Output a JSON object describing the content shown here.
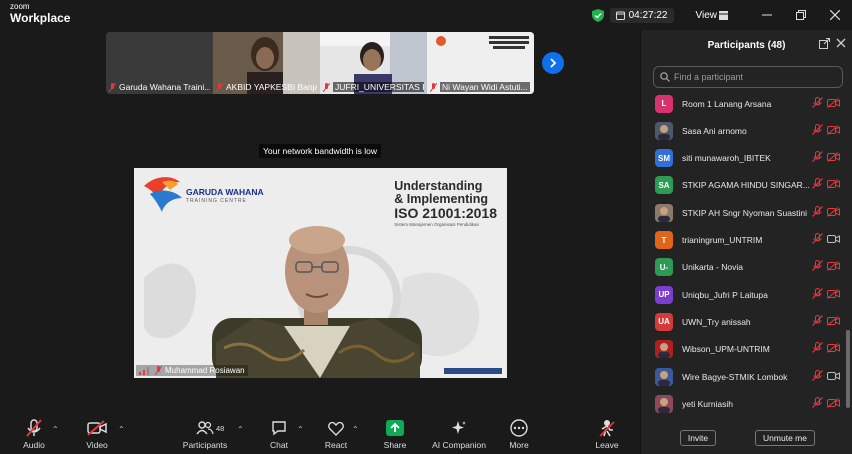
{
  "brand": {
    "line1": "zoom",
    "line2": "Workplace"
  },
  "titlebar": {
    "time": "04:27:22",
    "view_label": "View"
  },
  "thumbnails": [
    {
      "name": "Garuda Wahana Traini..."
    },
    {
      "name": "AKBID YAPKESBI Banja..."
    },
    {
      "name": "JUFRI_UNIVERSITAS R..."
    },
    {
      "name": "Ni Wayan Widi Astuti..."
    }
  ],
  "notice": "Your network bandwidth is low",
  "main_video": {
    "name": "Muhammad Rosiawan",
    "logo_title": "GARUDA WAHANA",
    "logo_sub": "TRAINING CENTRE",
    "slide_line1": "Understanding",
    "slide_line2": "& Implementing",
    "slide_line3": "ISO 21001:2018",
    "slide_line4": "Sistem Manajemen Organisasi Pendidikan"
  },
  "toolbar": {
    "audio": "Audio",
    "video": "Video",
    "participants": "Participants",
    "participants_count": "48",
    "chat": "Chat",
    "react": "React",
    "share": "Share",
    "ai": "AI Companion",
    "more": "More",
    "leave": "Leave"
  },
  "panel": {
    "title": "Participants (48)",
    "search_placeholder": "Find a participant",
    "invite": "Invite",
    "unmute": "Unmute me"
  },
  "participants": [
    {
      "initials": "L",
      "color": "#d6336c",
      "name": "Room 1 Lanang Arsana",
      "photo": false,
      "cam": "off"
    },
    {
      "initials": "",
      "color": "#4a5a6a",
      "name": "Sasa Ani arnomo",
      "photo": true,
      "cam": "off"
    },
    {
      "initials": "SM",
      "color": "#2f6fd6",
      "name": "siti munawaroh_IBITEK",
      "photo": false,
      "cam": "off"
    },
    {
      "initials": "SA",
      "color": "#2e9a55",
      "name": "STKIP AGAMA HINDU SINGAR...",
      "photo": false,
      "cam": "off"
    },
    {
      "initials": "",
      "color": "#8a7a6a",
      "name": "STKIP AH Sngr Nyoman Suastini",
      "photo": true,
      "cam": "off"
    },
    {
      "initials": "T",
      "color": "#e0651b",
      "name": "trianingrum_UNTRIM",
      "photo": false,
      "cam": "on"
    },
    {
      "initials": "U-",
      "color": "#2e9a55",
      "name": "Unikarta - Novia",
      "photo": false,
      "cam": "off"
    },
    {
      "initials": "UP",
      "color": "#7b3fd0",
      "name": "Uniqbu_Jufri P Laitupa",
      "photo": false,
      "cam": "off"
    },
    {
      "initials": "UA",
      "color": "#d43a3a",
      "name": "UWN_Try anissah",
      "photo": false,
      "cam": "off"
    },
    {
      "initials": "",
      "color": "#b02020",
      "name": "Wibson_UPM-UNTRIM",
      "photo": true,
      "cam": "off"
    },
    {
      "initials": "",
      "color": "#3a5a9a",
      "name": "Wire Bagye-STMIK Lombok",
      "photo": true,
      "cam": "on"
    },
    {
      "initials": "",
      "color": "#8a4a5a",
      "name": "yeti Kurniasih",
      "photo": true,
      "cam": "off"
    }
  ],
  "colors": {
    "accent": "#0e71eb",
    "mute_red": "#e0393e",
    "share_green": "#0fa958"
  }
}
